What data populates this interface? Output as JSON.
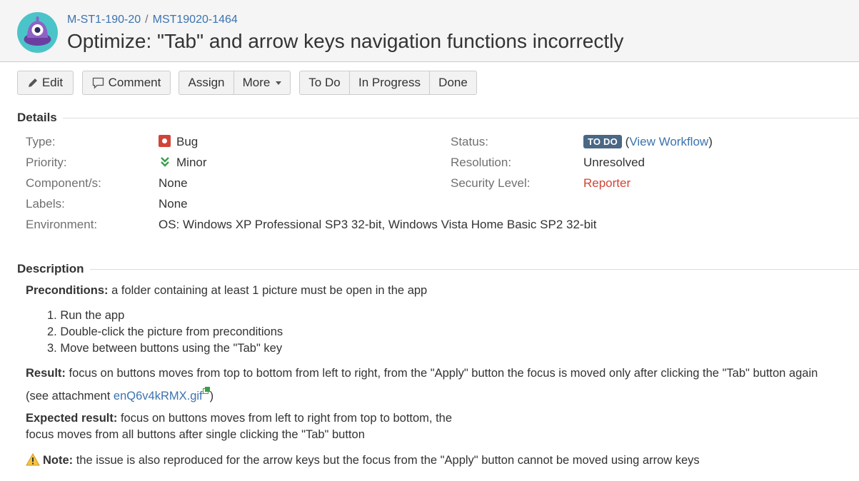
{
  "header": {
    "breadcrumb_project": "M-ST1-190-20",
    "breadcrumb_separator": "/",
    "breadcrumb_issue": "MST19020-1464",
    "summary": "Optimize: \"Tab\" and arrow keys navigation functions incorrectly"
  },
  "toolbar": {
    "edit": "Edit",
    "comment": "Comment",
    "assign": "Assign",
    "more": "More",
    "todo": "To Do",
    "in_progress": "In Progress",
    "done": "Done"
  },
  "details": {
    "heading": "Details",
    "type_label": "Type:",
    "type_value": "Bug",
    "priority_label": "Priority:",
    "priority_value": "Minor",
    "components_label": "Component/s:",
    "components_value": "None",
    "labels_label": "Labels:",
    "labels_value": "None",
    "environment_label": "Environment:",
    "environment_value": "OS: Windows XP Professional SP3 32-bit, Windows Vista Home Basic SP2 32-bit",
    "status_label": "Status:",
    "status_value": "TO DO",
    "view_workflow_open": "(",
    "view_workflow": "View Workflow",
    "view_workflow_close": ")",
    "resolution_label": "Resolution:",
    "resolution_value": "Unresolved",
    "security_label": "Security Level:",
    "security_value": "Reporter"
  },
  "description": {
    "heading": "Description",
    "preconditions_label": "Preconditions:",
    "preconditions_text": " a folder containing at least 1 picture must be open in the app",
    "steps": [
      "1. Run the app",
      "2. Double-click the picture from preconditions",
      "3. Move between buttons using the \"Tab\" key"
    ],
    "result_label": "Result:",
    "result_text": " focus on buttons moves from top to bottom from left to right, from the \"Apply\" button the focus is moved only after clicking the \"Tab\" button again",
    "result_attach_prefix": "(see attachment ",
    "result_attach_link": "enQ6v4kRMX.gif",
    "result_attach_suffix": ")",
    "expected_label": "Expected result:",
    "expected_text_1": " focus on buttons moves from left to right from top to bottom, the",
    "expected_text_2": "focus moves from all buttons after single clicking the \"Tab\" button",
    "note_label": "Note:",
    "note_text": " the issue is also reproduced for the arrow keys but the focus from the \"Apply\" button cannot be moved using arrow keys"
  },
  "colors": {
    "link": "#3b73af",
    "bug": "#d04437",
    "priority": "#3b9d4a",
    "lozenge": "#4a6785",
    "security": "#d04437",
    "warning": "#f6c342"
  },
  "icons": {
    "avatar": "project-avatar-icon",
    "edit": "pencil-icon",
    "comment": "speech-bubble-icon",
    "more": "chevron-down-icon",
    "type": "bug-icon",
    "priority": "double-chevron-down-icon",
    "note": "warning-icon",
    "attachment": "external-link-icon"
  }
}
